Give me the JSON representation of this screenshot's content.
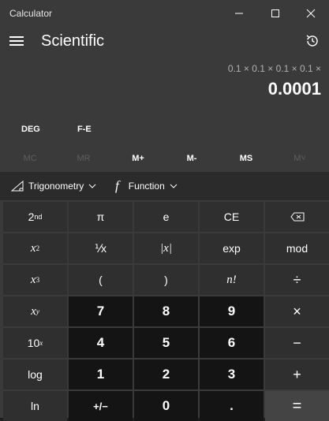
{
  "window": {
    "title": "Calculator",
    "minimize_icon": "minimize-icon",
    "maximize_icon": "maximize-icon",
    "close_icon": "close-icon"
  },
  "header": {
    "menu_icon": "hamburger-menu-icon",
    "mode": "Scientific",
    "history_icon": "history-icon"
  },
  "display": {
    "expression": "0.1 × 0.1 × 0.1 × 0.1 ×",
    "value": "0.0001"
  },
  "modes": {
    "angle": "DEG",
    "fe": "F-E"
  },
  "memory": {
    "buttons": [
      {
        "label": "MC",
        "enabled": false
      },
      {
        "label": "MR",
        "enabled": false
      },
      {
        "label": "M+",
        "enabled": true
      },
      {
        "label": "M-",
        "enabled": true
      },
      {
        "label": "MS",
        "enabled": true
      },
      {
        "label": "M˅",
        "enabled": false
      }
    ]
  },
  "toolbar": {
    "trig_label": "Trigonometry",
    "trig_icon": "triangle-icon",
    "func_label": "Function",
    "func_icon": "function-f-icon"
  },
  "keys": {
    "second": {
      "base": "2",
      "sup": "nd"
    },
    "pi": "π",
    "e": "e",
    "ce": "CE",
    "backspace_icon": "backspace-icon",
    "x_squared": {
      "base": "x",
      "sup": "2"
    },
    "reciprocal": "⅟x",
    "abs": "|x|",
    "exp": "exp",
    "mod": "mod",
    "x_cubed": {
      "base": "x",
      "sup": "3"
    },
    "open_paren": "(",
    "close_paren": ")",
    "factorial": "n!",
    "divide": "÷",
    "x_pow_y": {
      "base": "x",
      "sup": "y"
    },
    "seven": "7",
    "eight": "8",
    "nine": "9",
    "multiply": "×",
    "ten_pow_x": {
      "base": "10",
      "sup": "x"
    },
    "four": "4",
    "five": "5",
    "six": "6",
    "minus": "−",
    "log": "log",
    "one": "1",
    "two": "2",
    "three": "3",
    "plus": "+",
    "ln": "ln",
    "negate": "+/−",
    "zero": "0",
    "decimal": ".",
    "equals": "="
  }
}
